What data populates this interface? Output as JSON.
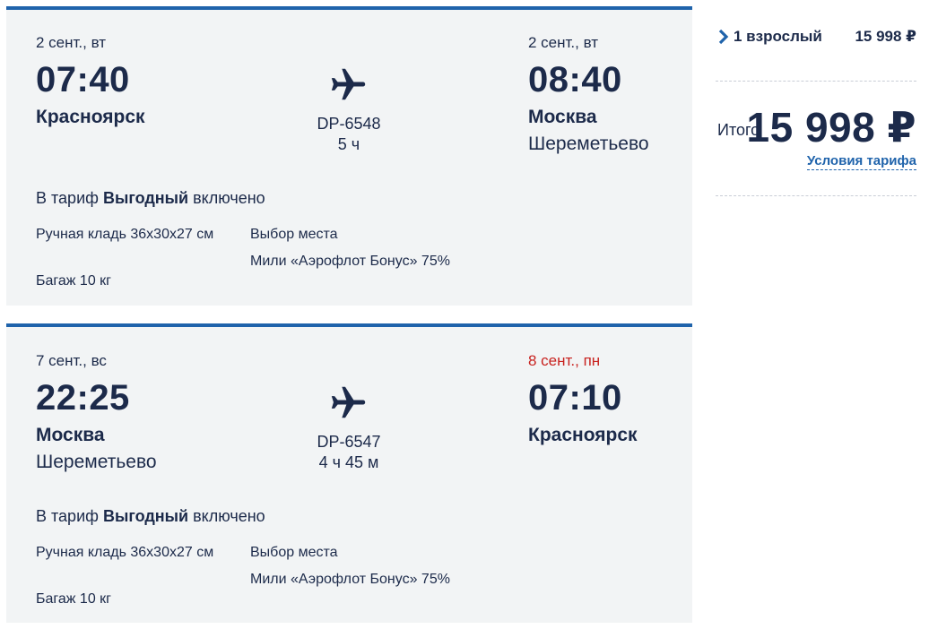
{
  "colors": {
    "brand_blue": "#1f63ab",
    "dark_text": "#1c2a4a",
    "alert_red": "#c8221f",
    "card_bg": "#f2f4f5"
  },
  "outbound": {
    "dep_date": "2 сент., вт",
    "dep_time": "07:40",
    "dep_city": "Красноярск",
    "flight_no": "DP-6548",
    "duration": "5 ч",
    "arr_date": "2 сент., вт",
    "arr_time": "08:40",
    "arr_city": "Москва",
    "arr_airport": "Шереметьево",
    "tariff_prefix": "В тариф",
    "tariff_name": "Выгодный",
    "tariff_suffix": "включено",
    "features_left": [
      "Ручная кладь 36х30х27 см",
      "Багаж 10 кг"
    ],
    "features_right": [
      "Выбор места",
      "Мили «Аэрофлот Бонус» 75%"
    ],
    "icon": "airplane-icon"
  },
  "return": {
    "dep_date": "7 сент., вс",
    "dep_time": "22:25",
    "dep_city": "Москва",
    "dep_airport": "Шереметьево",
    "flight_no": "DP-6547",
    "duration": "4 ч 45 м",
    "arr_date": "8 сент., пн",
    "arr_time": "07:10",
    "arr_city": "Красноярск",
    "tariff_prefix": "В тариф",
    "tariff_name": "Выгодный",
    "tariff_suffix": "включено",
    "features_left": [
      "Ручная кладь 36х30х27 см",
      "Багаж 10 кг"
    ],
    "features_right": [
      "Выбор места",
      "Мили «Аэрофлот Бонус» 75%"
    ],
    "icon": "airplane-icon"
  },
  "summary": {
    "passenger_label": "1 взрослый",
    "passenger_price": "15 998 ₽",
    "total_label": "Итого",
    "total_value": "15 998 ₽",
    "tariff_link": "Условия тарифа",
    "chevron_icon": "chevron-right-icon"
  }
}
